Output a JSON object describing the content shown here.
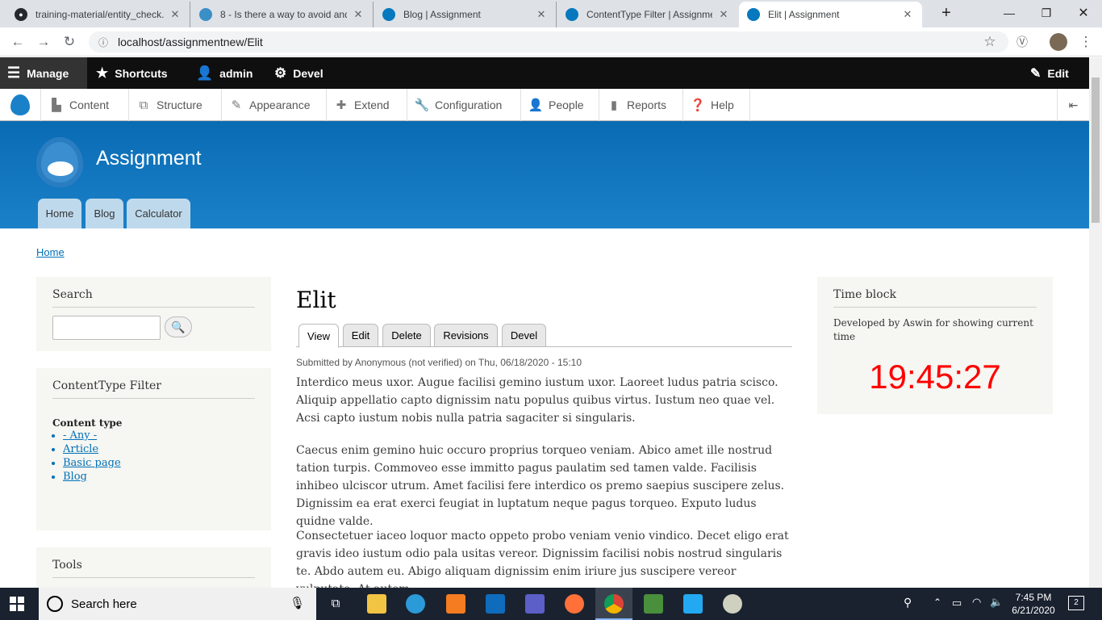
{
  "browser": {
    "tabs": [
      {
        "title": "training-material/entity_check...",
        "icon": "github-icon"
      },
      {
        "title": "8 - Is there a way to avoid and...",
        "icon": "drupal-answers-icon"
      },
      {
        "title": "Blog | Assignment",
        "icon": "drupal-icon"
      },
      {
        "title": "ContentType Filter | Assignment",
        "icon": "drupal-icon"
      },
      {
        "title": "Elit | Assignment",
        "icon": "drupal-icon"
      }
    ],
    "url": "localhost/assignmentnew/Elit"
  },
  "admin_toolbar": {
    "manage": "Manage",
    "shortcuts": "Shortcuts",
    "user": "admin",
    "devel": "Devel",
    "edit": "Edit"
  },
  "admin_tray": [
    "Content",
    "Structure",
    "Appearance",
    "Extend",
    "Configuration",
    "People",
    "Reports",
    "Help"
  ],
  "site": {
    "name": "Assignment",
    "menu": [
      "Home",
      "Blog",
      "Calculator"
    ]
  },
  "breadcrumb": "Home",
  "sidebar_left": {
    "search_title": "Search",
    "filter_title": "ContentType Filter",
    "content_type_label": "Content type",
    "filter_items": [
      "- Any -",
      "Article",
      "Basic page",
      "Blog"
    ],
    "tools_title": "Tools"
  },
  "node": {
    "title": "Elit",
    "tabs": [
      "View",
      "Edit",
      "Delete",
      "Revisions",
      "Devel"
    ],
    "submitted": "Submitted by Anonymous (not verified) on Thu, 06/18/2020 - 15:10",
    "paragraphs": [
      "Interdico meus uxor. Augue facilisi gemino iustum uxor. Laoreet ludus patria scisco. Aliquip appellatio capto dignissim natu populus quibus virtus. Iustum neo quae vel. Acsi capto iustum nobis nulla patria sagaciter si singularis.",
      "Caecus enim gemino huic occuro proprius torqueo veniam. Abico amet ille nostrud tation turpis. Commoveo esse immitto pagus paulatim sed tamen valde. Facilisis inhibeo ulciscor utrum. Amet facilisi fere interdico os premo saepius suscipere zelus. Dignissim ea erat exerci feugiat in luptatum neque pagus torqueo. Exputo ludus quidne valde.",
      "Consectetuer iaceo loquor macto oppeto probo veniam venio vindico. Decet eligo erat gravis ideo iustum odio pala usitas vereor. Dignissim facilisi nobis nostrud singularis te. Abdo autem eu. Abigo aliquam dignissim enim iriure jus suscipere vereor vulputate. At autem"
    ]
  },
  "time_block": {
    "title": "Time block",
    "description": "Developed by Aswin for showing current time",
    "time": "19:45:27"
  },
  "taskbar": {
    "search_placeholder": "Search here",
    "time": "7:45 PM",
    "date": "6/21/2020",
    "notifications": "2"
  },
  "colors": {
    "header_blue": "#0a6bb3",
    "link_blue": "#0071b8",
    "clock_red": "#ff0000"
  }
}
